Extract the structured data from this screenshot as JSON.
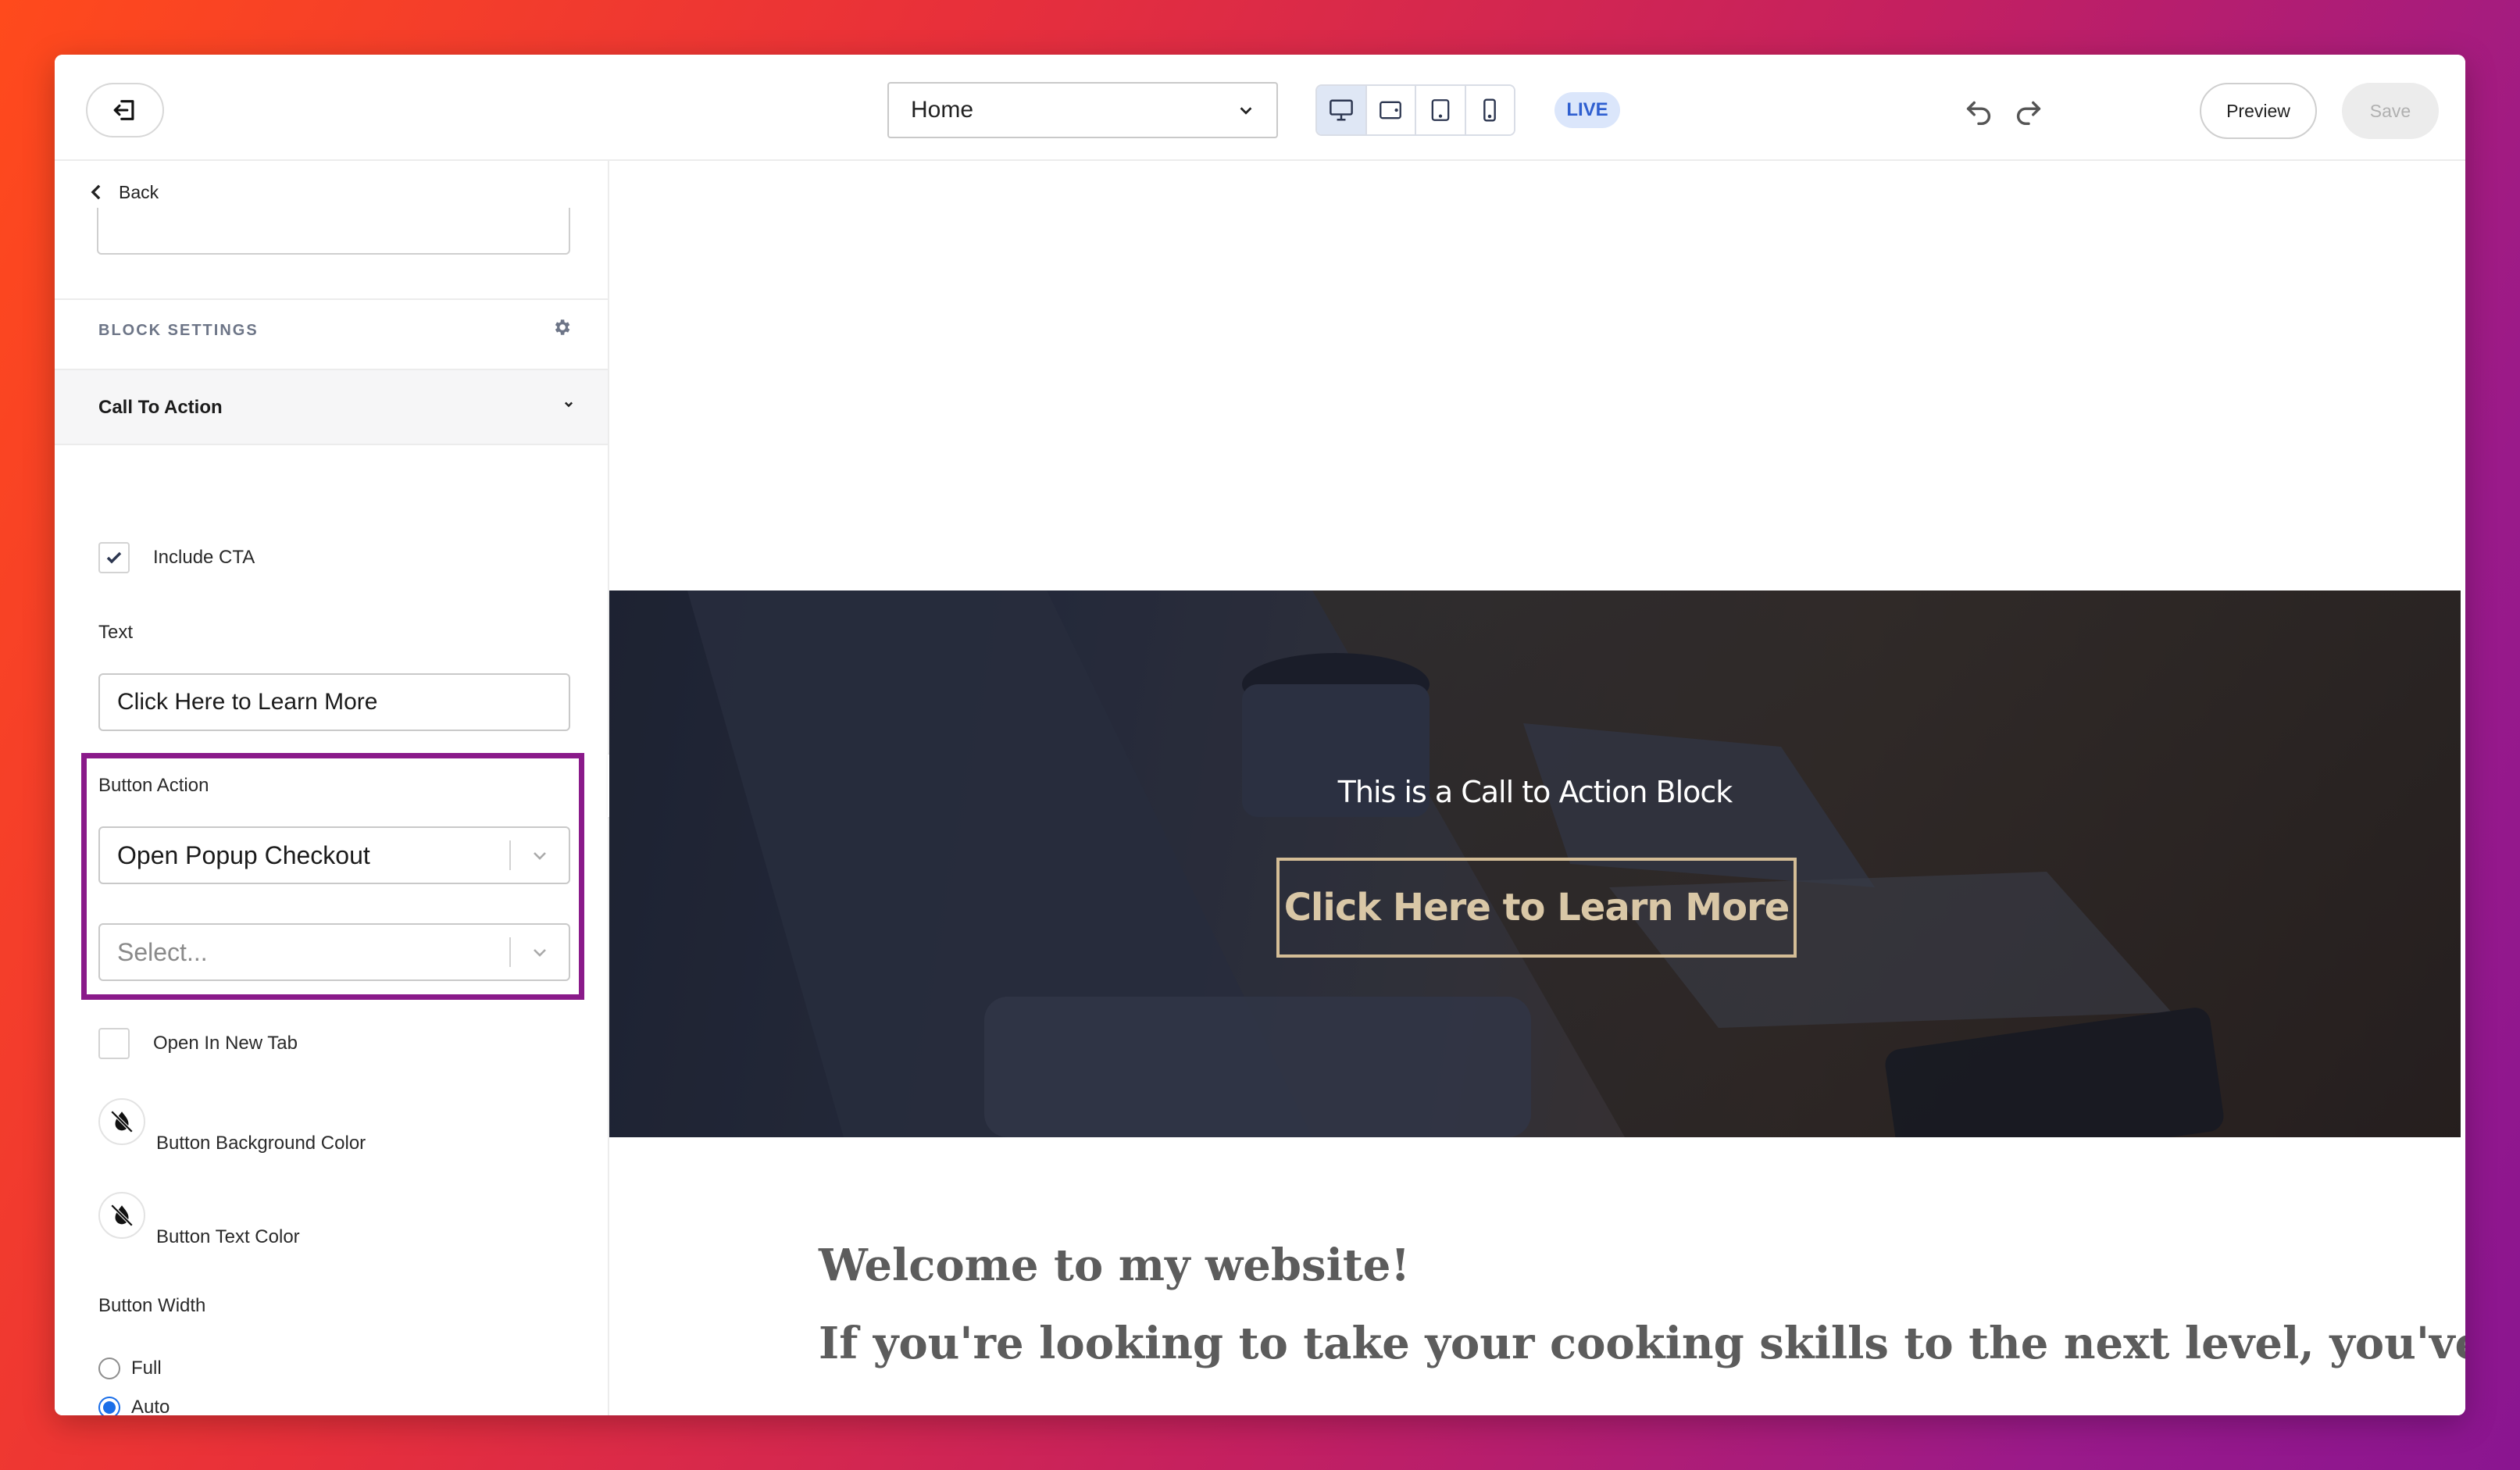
{
  "topbar": {
    "page_select_value": "Home",
    "live_badge": "LIVE",
    "preview_label": "Preview",
    "save_label": "Save",
    "device_icons": [
      "desktop-icon",
      "tablet-landscape-icon",
      "tablet-portrait-icon",
      "mobile-icon"
    ]
  },
  "sidebar": {
    "back_label": "Back",
    "block_settings_label": "BLOCK SETTINGS",
    "section_title": "Call To Action",
    "include_cta_label": "Include CTA",
    "include_cta_checked": true,
    "text_label": "Text",
    "text_value": "Click Here to Learn More",
    "button_action_label": "Button Action",
    "button_action_value": "Open Popup Checkout",
    "secondary_select_placeholder": "Select...",
    "open_new_tab_label": "Open In New Tab",
    "button_bg_color_label": "Button Background Color",
    "button_text_color_label": "Button Text Color",
    "button_width_label": "Button Width",
    "width_options": [
      {
        "label": "Full",
        "checked": false
      },
      {
        "label": "Auto",
        "checked": true
      }
    ],
    "highlight_color": "#8a1a8a"
  },
  "canvas": {
    "cta_title": "This is a Call to Action Block",
    "cta_button_label": "Click Here to Learn More",
    "welcome_heading": "Welcome to my website!",
    "welcome_text": "If you're looking to take your cooking skills to the next level, you've"
  }
}
